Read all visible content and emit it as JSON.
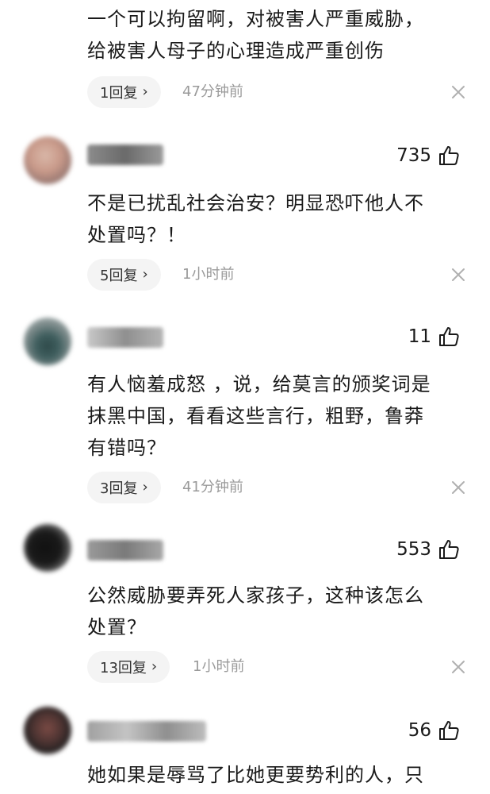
{
  "comments": [
    {
      "text": "一个可以拘留啊，对被害人严重威胁，\n给被害人母子的心理造成严重创伤",
      "reply_label": "1回复",
      "time": "47分钟前"
    },
    {
      "likes": "735",
      "text": "不是已扰乱社会治安？明显恐吓他人不\n处置吗？！",
      "reply_label": "5回复",
      "time": "1小时前"
    },
    {
      "likes": "11",
      "text": "有人恼羞成怒 ，说，给莫言的颁奖词是\n抹黑中国，看看这些言行，粗野，鲁莽\n有错吗？",
      "reply_label": "3回复",
      "time": "41分钟前"
    },
    {
      "likes": "553",
      "text": "公然威胁要弄死人家孩子，这种该怎么\n处置？",
      "reply_label": "13回复",
      "time": "1小时前"
    },
    {
      "likes": "56",
      "text": "她如果是辱骂了比她更要势利的人，只"
    }
  ],
  "chevron_glyph": "›",
  "icons": {
    "like": "thumbs-up-outline",
    "close": "x"
  },
  "colors": {
    "text": "#1a1a1a",
    "meta": "#9a9a9a",
    "pill_bg": "#f4f4f4",
    "close": "#b0b0b0"
  }
}
